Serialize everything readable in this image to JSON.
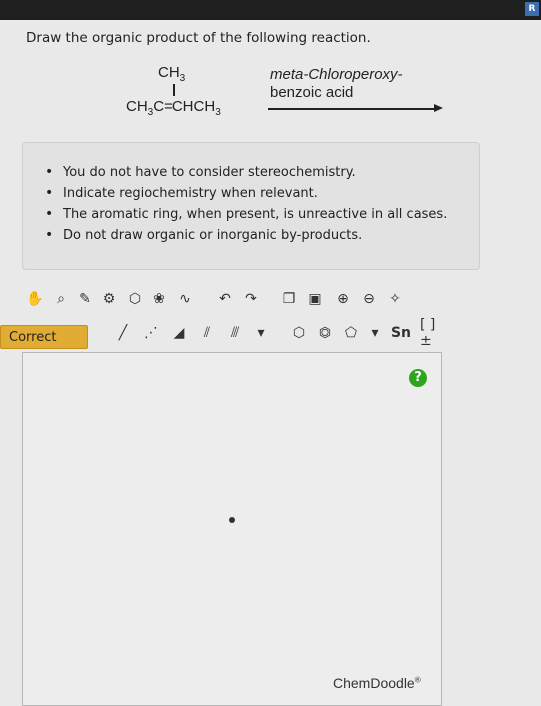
{
  "question": {
    "prompt": "Draw the organic product of the following reaction."
  },
  "reaction": {
    "reactant_top": "CH3",
    "reactant_main": "CH3C=CHCH3",
    "reagent_line1": "meta-Chloroperoxy-",
    "reagent_line2": "benzoic acid"
  },
  "notes": {
    "items": [
      "You do not have to consider stereochemistry.",
      "Indicate regiochemistry when relevant.",
      "The aromatic ring, when present, is unreactive in all cases.",
      "Do not draw organic or inorganic by-products."
    ]
  },
  "status": {
    "label": "Correct",
    "color": "#e0ac34"
  },
  "toolbar": {
    "chain_label": "Sn",
    "bracket_label": "[ ]±"
  },
  "editor": {
    "help_label": "?",
    "brand": "ChemDoodle",
    "brand_mark": "®"
  },
  "colors": {
    "help": "#2fa51f",
    "accent": "#3a6fb0"
  }
}
